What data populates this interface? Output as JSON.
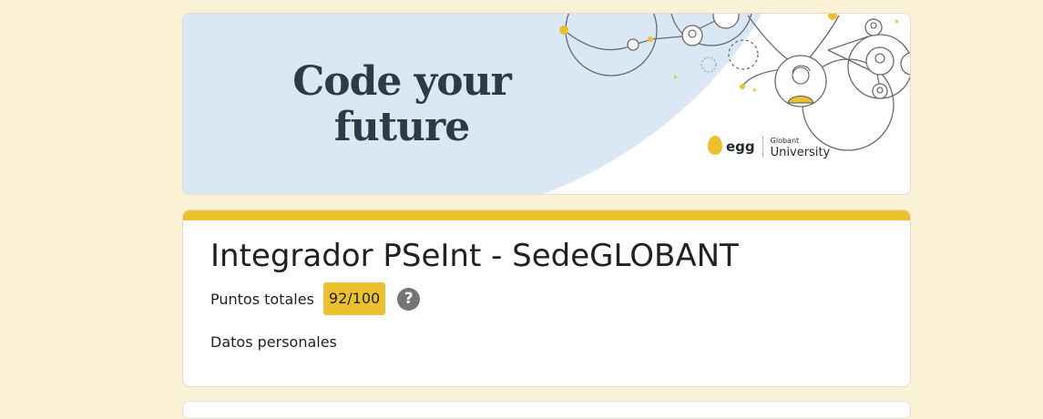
{
  "banner": {
    "title_line1": "Code your",
    "title_line2": "future",
    "brand_name": "egg",
    "university_small": "Globant",
    "university_big": "University"
  },
  "form": {
    "title": "Integrador PSeInt - SedeGLOBANT",
    "points_label": "Puntos totales",
    "score": "92/100",
    "help_icon": "help-circle-icon",
    "section_label": "Datos personales"
  },
  "colors": {
    "page_background": "#faf1d6",
    "accent": "#ebc12f",
    "banner_blue": "#dae7f5",
    "title_text": "#2e3b44"
  }
}
